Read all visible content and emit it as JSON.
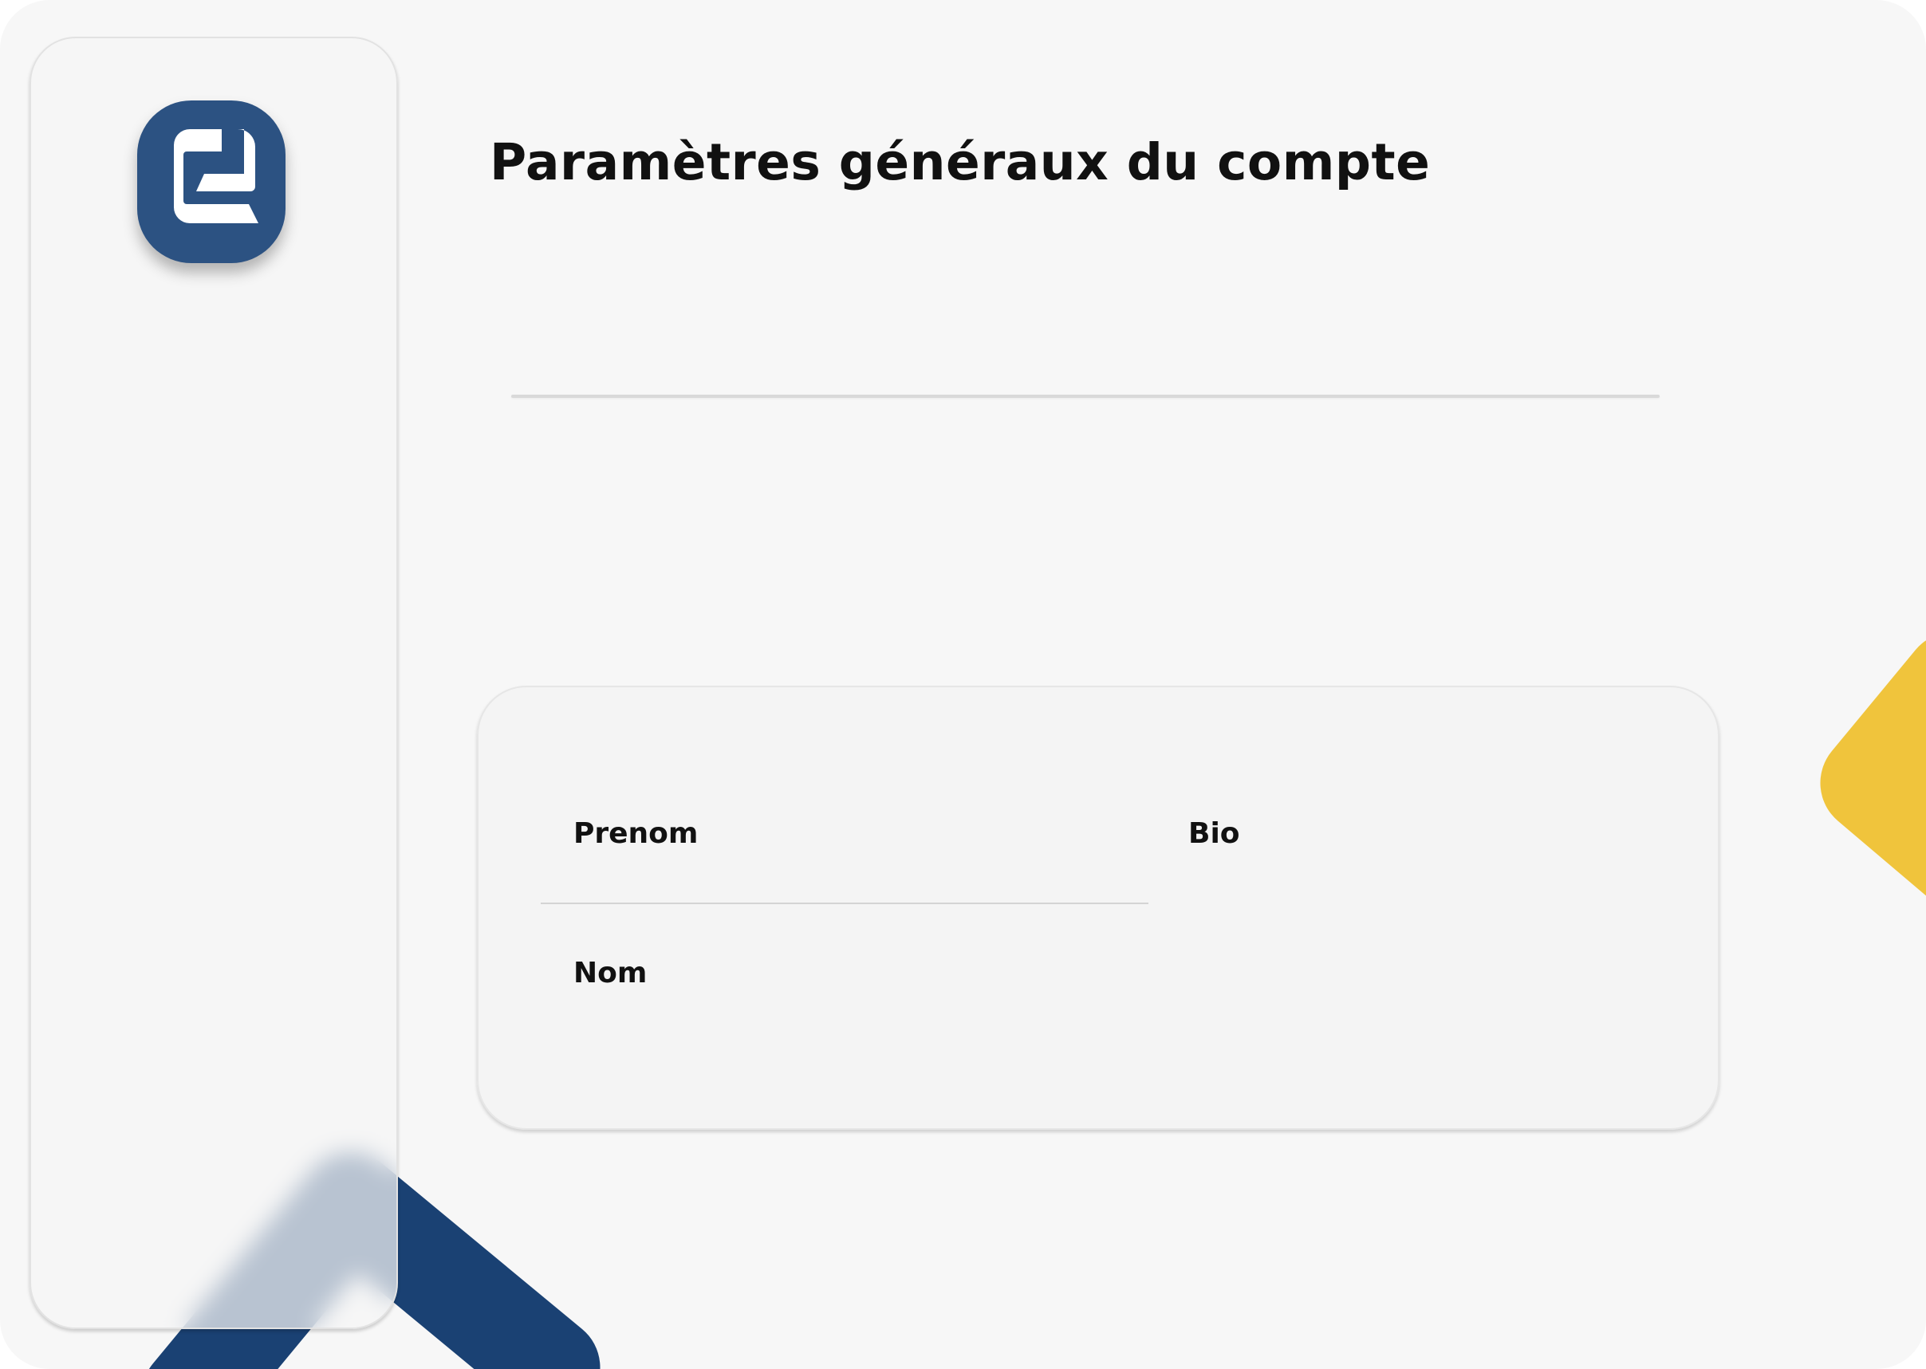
{
  "header": {
    "title": "Paramètres généraux du compte"
  },
  "sidebar": {
    "logo_icon": "app-logo-icon",
    "brand_color": "#2c5282"
  },
  "form": {
    "fields": [
      {
        "label": "Prenom",
        "value": ""
      },
      {
        "label": "Nom",
        "value": ""
      },
      {
        "label": "Bio",
        "value": ""
      }
    ]
  },
  "colors": {
    "accent_navy": "#1a4173",
    "accent_yellow": "#f0c43c",
    "background": "#f7f7f7"
  }
}
